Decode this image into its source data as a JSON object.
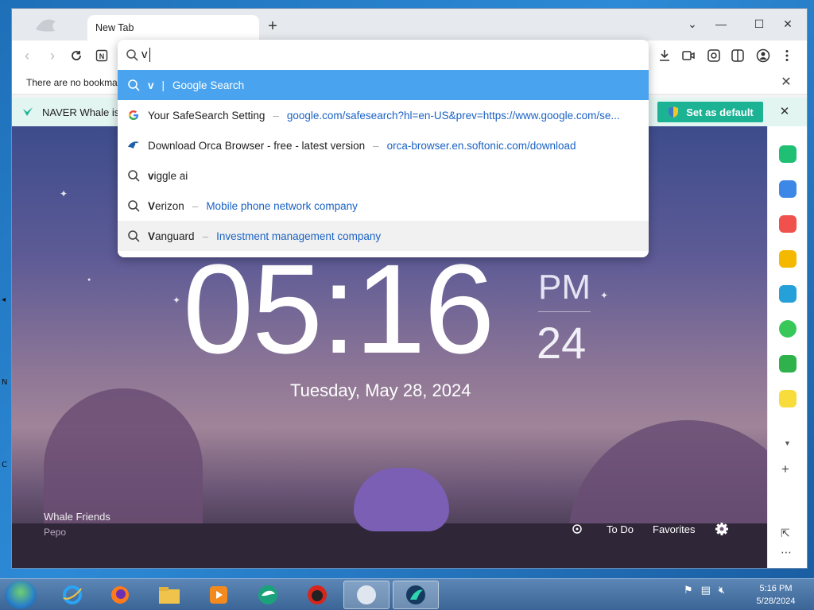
{
  "browser": {
    "tab_title": "New Tab",
    "omnibox_query": "v",
    "bookmark_bar_text": "There are no bookma",
    "infobar_text": "NAVER Whale is",
    "set_default_label": "Set as default"
  },
  "suggestions": [
    {
      "icon": "search-icon",
      "bold": "v",
      "text": "",
      "sep": "|",
      "url": "Google Search",
      "selected": true
    },
    {
      "icon": "google-icon",
      "bold": "",
      "text": "Your SafeSearch Setting",
      "sep": "–",
      "url": "google.com/safesearch?hl=en-US&prev=https://www.google.com/se..."
    },
    {
      "icon": "orca-icon",
      "bold": "",
      "text": "Download Orca Browser - free - latest version",
      "sep": "–",
      "url": "orca-browser.en.softonic.com/download"
    },
    {
      "icon": "search-icon",
      "bold": "v",
      "text": "iggle ai",
      "sep": "",
      "url": ""
    },
    {
      "icon": "search-icon",
      "bold": "V",
      "text": "erizon",
      "sep": "–",
      "url": "Mobile phone network company"
    },
    {
      "icon": "search-icon",
      "bold": "V",
      "text": "anguard",
      "sep": "–",
      "url": "Investment management company",
      "hover": true
    }
  ],
  "newtab": {
    "clock": "05:16",
    "ampm": "PM",
    "seconds": "24",
    "date": "Tuesday, May 28, 2024",
    "friends_title": "Whale Friends",
    "friends_sub": "Pepo",
    "todo": "To Do",
    "favorites": "Favorites"
  },
  "taskbar": {
    "time": "5:16 PM",
    "date": "5/28/2024"
  },
  "colors": {
    "accent": "#1bb394",
    "selected_row": "#4aa3ee",
    "link": "#1a62c4"
  }
}
